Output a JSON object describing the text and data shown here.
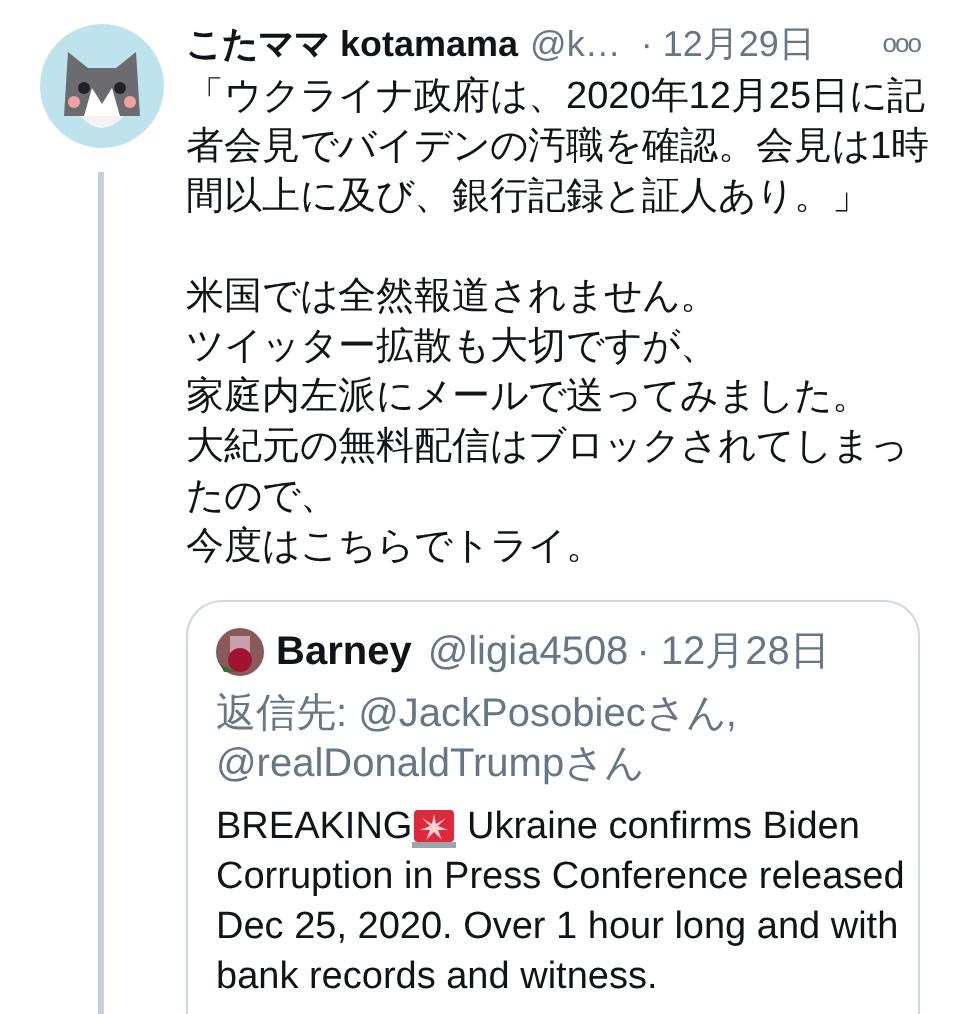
{
  "tweet": {
    "display_name": "こたママ kotamama",
    "handle": "@k…",
    "date": "· 12月29日",
    "more": "ooo",
    "paragraphs": [
      [
        "「ウクライナ政府は、2020年12月25日に記",
        "者会見でバイデンの汚職を確認。会見は1時",
        "間以上に及び、銀行記録と証人あり。」"
      ],
      [
        "米国では全然報道されません。",
        "ツイッター拡散も大切ですが、",
        "家庭内左派にメールで送ってみました。",
        "大紀元の無料配信はブロックされてしまっ",
        "たので、",
        "今度はこちらでトライ。"
      ]
    ]
  },
  "quoted_tweet": {
    "display_name": "Barney",
    "handle": "@ligia4508",
    "date": "· 12月28日",
    "reply_to": [
      "返信先: @JackPosobiecさん,",
      "@realDonaldTrumpさん"
    ],
    "text_before_icon": "BREAKING",
    "text_after_icon": " Ukraine confirms Biden",
    "lines": [
      "Corruption in Press Conference released",
      "Dec 25, 2020. Over 1 hour long and with",
      "bank records and witness."
    ]
  }
}
